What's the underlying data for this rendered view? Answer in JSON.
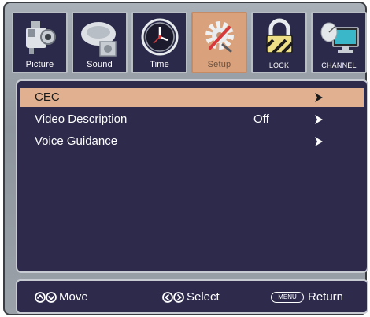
{
  "tabs": [
    {
      "label": "Picture",
      "icon": "camcorder-icon",
      "active": false
    },
    {
      "label": "Sound",
      "icon": "speaker-icon",
      "active": false
    },
    {
      "label": "Time",
      "icon": "clock-icon",
      "active": false
    },
    {
      "label": "Setup",
      "icon": "gear-wrench-icon",
      "active": true
    },
    {
      "label": "LOCK",
      "icon": "padlock-icon",
      "active": false
    },
    {
      "label": "CHANNEL",
      "icon": "satellite-tv-icon",
      "active": false
    }
  ],
  "menu": {
    "items": [
      {
        "label": "CEC",
        "value": "",
        "selected": true
      },
      {
        "label": "Video Description",
        "value": "Off",
        "selected": false
      },
      {
        "label": "Voice Guidance",
        "value": "",
        "selected": false
      }
    ]
  },
  "footer": {
    "move_label": "Move",
    "select_label": "Select",
    "menu_key": "MENU",
    "return_label": "Return"
  },
  "colors": {
    "panel_bg": "#2d2a4c",
    "highlight": "#e0b090",
    "active_tab": "#d9a27c"
  }
}
